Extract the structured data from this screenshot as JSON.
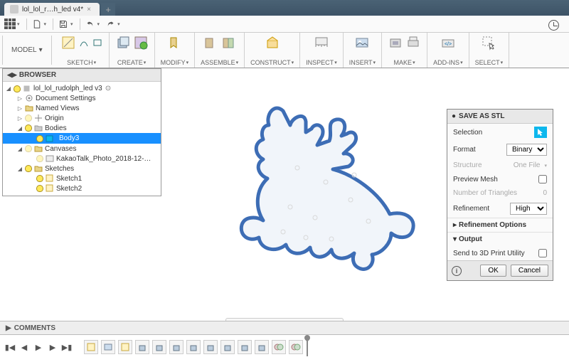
{
  "tab": {
    "title": "lol_lol_r…h_led v4*"
  },
  "quickbar": {
    "model_label": "MODEL"
  },
  "ribbon": [
    {
      "label": "SKETCH"
    },
    {
      "label": "CREATE"
    },
    {
      "label": "MODIFY"
    },
    {
      "label": "ASSEMBLE"
    },
    {
      "label": "CONSTRUCT"
    },
    {
      "label": "INSPECT"
    },
    {
      "label": "INSERT"
    },
    {
      "label": "MAKE"
    },
    {
      "label": "ADD-INS"
    },
    {
      "label": "SELECT"
    }
  ],
  "browser": {
    "title": "BROWSER",
    "root": "lol_lol_rudolph_led v3",
    "nodes": {
      "doc_settings": "Document Settings",
      "named_views": "Named Views",
      "origin": "Origin",
      "bodies": "Bodies",
      "body3": "Body3",
      "canvases": "Canvases",
      "canvas1": "KakaoTalk_Photo_2018-12-…",
      "sketches": "Sketches",
      "sketch1": "Sketch1",
      "sketch2": "Sketch2"
    }
  },
  "dialog": {
    "title": "SAVE AS STL",
    "selection_label": "Selection",
    "format_label": "Format",
    "format_value": "Binary",
    "structure_label": "Structure",
    "structure_value": "One File",
    "preview_label": "Preview Mesh",
    "triangles_label": "Number of Triangles",
    "triangles_value": "0",
    "refinement_label": "Refinement",
    "refinement_value": "High",
    "refine_opts": "Refinement Options",
    "output": "Output",
    "send_label": "Send to 3D Print Utility",
    "ok": "OK",
    "cancel": "Cancel"
  },
  "comments": {
    "label": "COMMENTS"
  }
}
